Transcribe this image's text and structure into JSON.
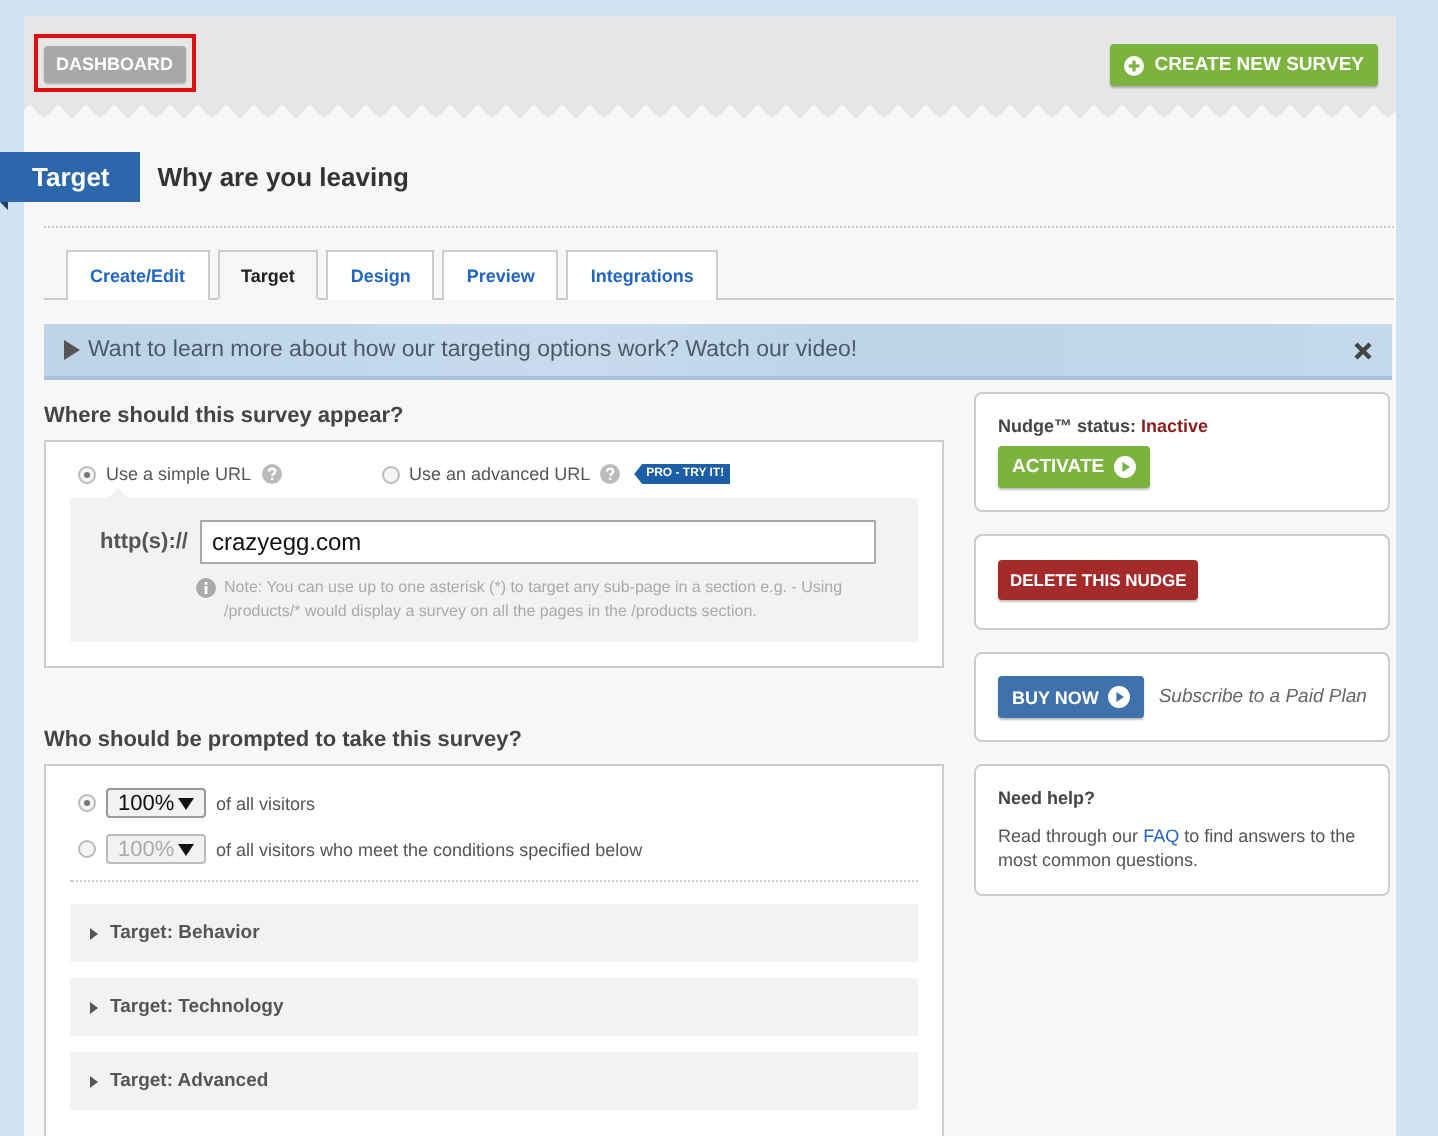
{
  "header": {
    "dashboard_button": {
      "label": "DASHBOARD",
      "highlighted": true
    },
    "create_button": "CREATE NEW SURVEY"
  },
  "page": {
    "section_tag": "Target",
    "title": "Why are you leaving"
  },
  "tabs": [
    {
      "label": "Create/Edit",
      "selected": false
    },
    {
      "label": "Target",
      "selected": true
    },
    {
      "label": "Design",
      "selected": false
    },
    {
      "label": "Preview",
      "selected": false
    },
    {
      "label": "Integrations",
      "selected": false
    }
  ],
  "video_banner": {
    "text": "Want to learn more about how our targeting options work? Watch our video!"
  },
  "appear_section": {
    "heading": "Where should this survey appear?",
    "url_options": [
      {
        "label": "Use a simple URL",
        "selected": true
      },
      {
        "label": "Use an advanced URL",
        "selected": false,
        "badge": "PRO - TRY IT!"
      }
    ],
    "url_prefix": "http(s)://",
    "url_value": "crazyegg.com",
    "note": "Note: You can use up to one asterisk (*) to target any sub-page in a section e.g. - Using /products/* would display a survey on all the pages in the /products section."
  },
  "prompt_section": {
    "heading": "Who should be prompted to take this survey?",
    "options": [
      {
        "selected": true,
        "percent": "100%",
        "label": "of all visitors",
        "disabled": false
      },
      {
        "selected": false,
        "percent": "100%",
        "label": "of all visitors who meet the conditions specified below",
        "disabled": true
      }
    ],
    "accordions": [
      {
        "label": "Target: Behavior",
        "expanded": false
      },
      {
        "label": "Target: Technology",
        "expanded": false
      },
      {
        "label": "Target: Advanced",
        "expanded": false
      }
    ]
  },
  "sidebar": {
    "status_label": "Nudge™ status:",
    "status_value": "Inactive",
    "activate_button": "ACTIVATE",
    "delete_button": "DELETE THIS NUDGE",
    "buy_button": "BUY NOW",
    "subscribe_text": "Subscribe to a Paid Plan",
    "help_title": "Need help?",
    "help_before": "Read through our ",
    "help_link": "FAQ",
    "help_after": " to find answers to the most common questions."
  }
}
